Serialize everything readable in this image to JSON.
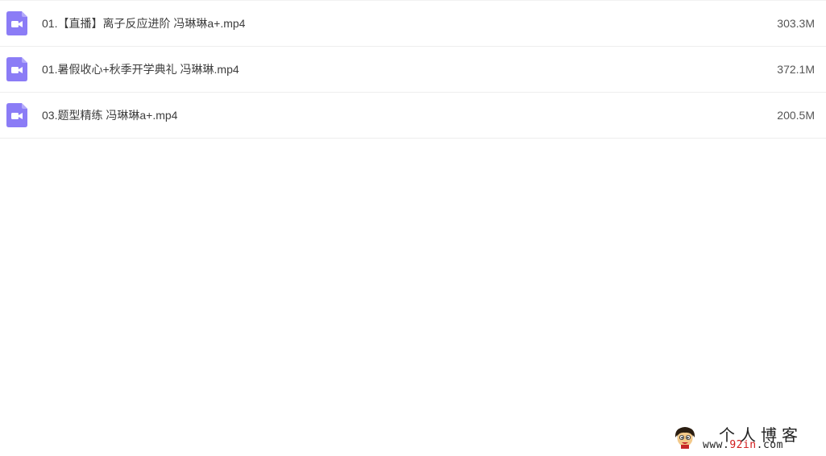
{
  "files": [
    {
      "name": "01.【直播】离子反应进阶 冯琳琳a+.mp4",
      "size": "303.3M",
      "icon": "video-file-icon"
    },
    {
      "name": "01.暑假收心+秋季开学典礼 冯琳琳.mp4",
      "size": "372.1M",
      "icon": "video-file-icon"
    },
    {
      "name": "03.题型精练 冯琳琳a+.mp4",
      "size": "200.5M",
      "icon": "video-file-icon"
    }
  ],
  "watermark": {
    "title": "个人博客",
    "url_prefix": "www.",
    "url_highlight": "92in",
    "url_suffix": ".com",
    "logo": "cartoon-face-logo"
  },
  "colors": {
    "icon_fill": "#8b7cf6",
    "row_border": "#eeeeee",
    "watermark_highlight": "#d11a1a"
  }
}
